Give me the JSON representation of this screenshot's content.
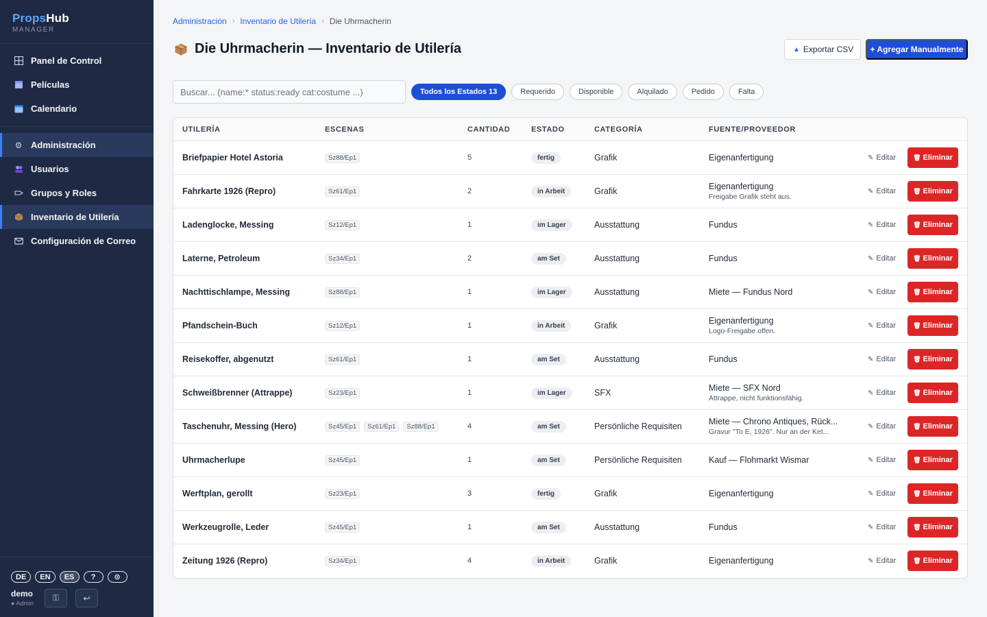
{
  "brand": {
    "name_a": "Props",
    "name_b": "Hub",
    "sub": "MANAGER"
  },
  "nav": {
    "group1": [
      {
        "label": "Panel de Control",
        "icon": "grid-icon"
      },
      {
        "label": "Películas",
        "icon": "clapperboard-icon"
      },
      {
        "label": "Calendario",
        "icon": "calendar-icon"
      }
    ],
    "group2": [
      {
        "label": "Administración",
        "icon": "gear-icon",
        "active": true
      },
      {
        "label": "Usuarios",
        "icon": "users-icon"
      },
      {
        "label": "Grupos y Roles",
        "icon": "tag-icon"
      },
      {
        "label": "Inventario de Utilería",
        "icon": "package-icon",
        "active": true
      },
      {
        "label": "Configuración de Correo",
        "icon": "mail-icon"
      }
    ]
  },
  "languages": [
    "DE",
    "EN",
    "ES",
    "?",
    "⊙"
  ],
  "active_language": "ES",
  "user": {
    "name": "demo",
    "role": "● Admin"
  },
  "breadcrumb": {
    "item1": "Administración",
    "item2": "Inventario de Utilería",
    "current": "Die Uhrmacherin"
  },
  "page": {
    "title": "Die Uhrmacherin — Inventario de Utilería"
  },
  "actions": {
    "export": "Exportar CSV",
    "add": "+ Agregar Manualmente"
  },
  "search": {
    "placeholder": "Buscar... (name:* status:ready cat:costume ...)"
  },
  "filters": [
    "Todos los Estados 13",
    "Requerido",
    "Disponible",
    "Alquilado",
    "Pedido",
    "Falta"
  ],
  "table": {
    "headers": {
      "name": "UTILERÍA",
      "scenes": "ESCENAS",
      "qty": "CANTIDAD",
      "status": "ESTADO",
      "category": "CATEGORÍA",
      "source": "FUENTE/PROVEEDOR"
    },
    "edit_label": "Editar",
    "delete_label": "Eliminar",
    "rows": [
      {
        "name": "Briefpapier Hotel Astoria",
        "scenes": [
          "Sz88/Ep1"
        ],
        "qty": "5",
        "status": "fertig",
        "category": "Grafik",
        "source": "Eigenanfertigung",
        "note": ""
      },
      {
        "name": "Fahrkarte 1926 (Repro)",
        "scenes": [
          "Sz61/Ep1"
        ],
        "qty": "2",
        "status": "in Arbeit",
        "category": "Grafik",
        "source": "Eigenanfertigung",
        "note": "Freigabe Grafik steht aus."
      },
      {
        "name": "Ladenglocke, Messing",
        "scenes": [
          "Sz12/Ep1"
        ],
        "qty": "1",
        "status": "im Lager",
        "category": "Ausstattung",
        "source": "Fundus",
        "note": ""
      },
      {
        "name": "Laterne, Petroleum",
        "scenes": [
          "Sz34/Ep1"
        ],
        "qty": "2",
        "status": "am Set",
        "category": "Ausstattung",
        "source": "Fundus",
        "note": ""
      },
      {
        "name": "Nachttischlampe, Messing",
        "scenes": [
          "Sz88/Ep1"
        ],
        "qty": "1",
        "status": "im Lager",
        "category": "Ausstattung",
        "source": "Miete — Fundus Nord",
        "note": ""
      },
      {
        "name": "Pfandschein-Buch",
        "scenes": [
          "Sz12/Ep1"
        ],
        "qty": "1",
        "status": "in Arbeit",
        "category": "Grafik",
        "source": "Eigenanfertigung",
        "note": "Logo-Freigabe offen."
      },
      {
        "name": "Reisekoffer, abgenutzt",
        "scenes": [
          "Sz61/Ep1"
        ],
        "qty": "1",
        "status": "am Set",
        "category": "Ausstattung",
        "source": "Fundus",
        "note": ""
      },
      {
        "name": "Schweißbrenner (Attrappe)",
        "scenes": [
          "Sz23/Ep1"
        ],
        "qty": "1",
        "status": "im Lager",
        "category": "SFX",
        "source": "Miete — SFX Nord",
        "note": "Attrappe, nicht funktionsfähig."
      },
      {
        "name": "Taschenuhr, Messing (Hero)",
        "scenes": [
          "Sz45/Ep1",
          "Sz61/Ep1",
          "Sz88/Ep1"
        ],
        "qty": "4",
        "status": "am Set",
        "category": "Persönliche Requisiten",
        "source": "Miete — Chrono Antiques, Rück...",
        "note": "Gravur \"To E, 1926\". Nur an der Ket..."
      },
      {
        "name": "Uhrmacherlupe",
        "scenes": [
          "Sz45/Ep1"
        ],
        "qty": "1",
        "status": "am Set",
        "category": "Persönliche Requisiten",
        "source": "Kauf — Flohmarkt Wismar",
        "note": ""
      },
      {
        "name": "Werftplan, gerollt",
        "scenes": [
          "Sz23/Ep1"
        ],
        "qty": "3",
        "status": "fertig",
        "category": "Grafik",
        "source": "Eigenanfertigung",
        "note": ""
      },
      {
        "name": "Werkzeugrolle, Leder",
        "scenes": [
          "Sz45/Ep1"
        ],
        "qty": "1",
        "status": "am Set",
        "category": "Ausstattung",
        "source": "Fundus",
        "note": ""
      },
      {
        "name": "Zeitung 1926 (Repro)",
        "scenes": [
          "Sz34/Ep1"
        ],
        "qty": "4",
        "status": "in Arbeit",
        "category": "Grafik",
        "source": "Eigenanfertigung",
        "note": ""
      }
    ]
  },
  "colors": {
    "sidebar": "#1e2a44",
    "primary": "#1d4ed8",
    "danger": "#dc2626",
    "link": "#2563eb"
  }
}
